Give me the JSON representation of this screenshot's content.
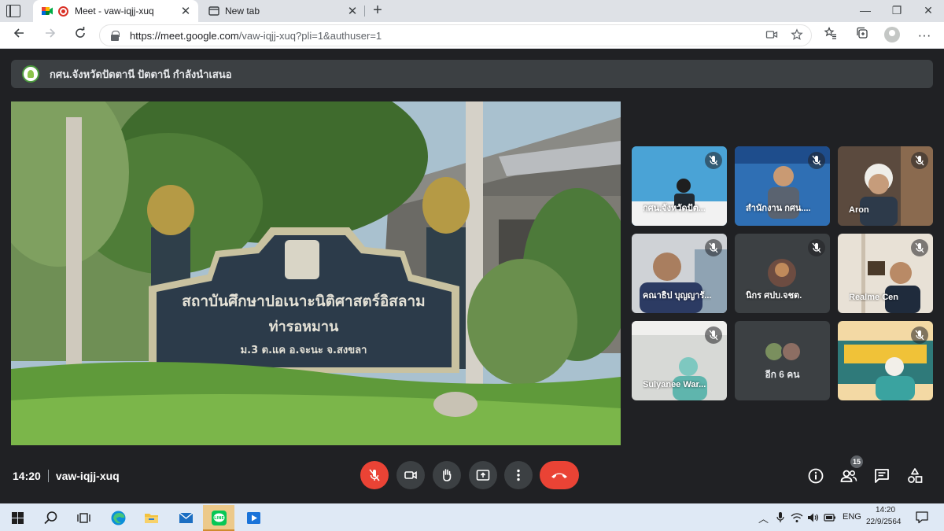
{
  "browser": {
    "tabs": [
      {
        "title": "Meet - vaw-iqjj-xuq",
        "active": true
      },
      {
        "title": "New tab",
        "active": false
      }
    ],
    "url_host": "https://meet.google.com",
    "url_path": "/vaw-iqjj-xuq?pli=1&authuser=1"
  },
  "meet": {
    "presenter_text": "กศน.จังหวัดปัตตานี ปัตตานี กำลังนำเสนอ",
    "participant_tiles": [
      {
        "name": "กศน.จังหวัดปัต...",
        "muted": true
      },
      {
        "name": "สำนักงาน กศน....",
        "muted": true
      },
      {
        "name": "Aron",
        "muted": true
      },
      {
        "name": "คณาธิป บุญญารั...",
        "muted": true
      },
      {
        "name": "นิกร ศปบ.จชต.",
        "muted": true
      },
      {
        "name": "Realme Cen",
        "muted": true
      },
      {
        "name": "Sulyanee War...",
        "muted": true
      },
      {
        "name": "อีก 6 คน",
        "muted": false
      },
      {
        "name": "",
        "muted": true
      }
    ],
    "time": "14:20",
    "meeting_code": "vaw-iqjj-xuq",
    "participant_count": "15",
    "colors": {
      "background": "#202124",
      "surface": "#3c4043",
      "danger": "#ea4335"
    }
  },
  "taskbar": {
    "apps": [
      "windows-start",
      "search",
      "task-view",
      "edge",
      "file-explorer",
      "mail",
      "line",
      "media-player"
    ],
    "language": "ENG",
    "clock_time": "14:20",
    "clock_date": "22/9/2564"
  }
}
